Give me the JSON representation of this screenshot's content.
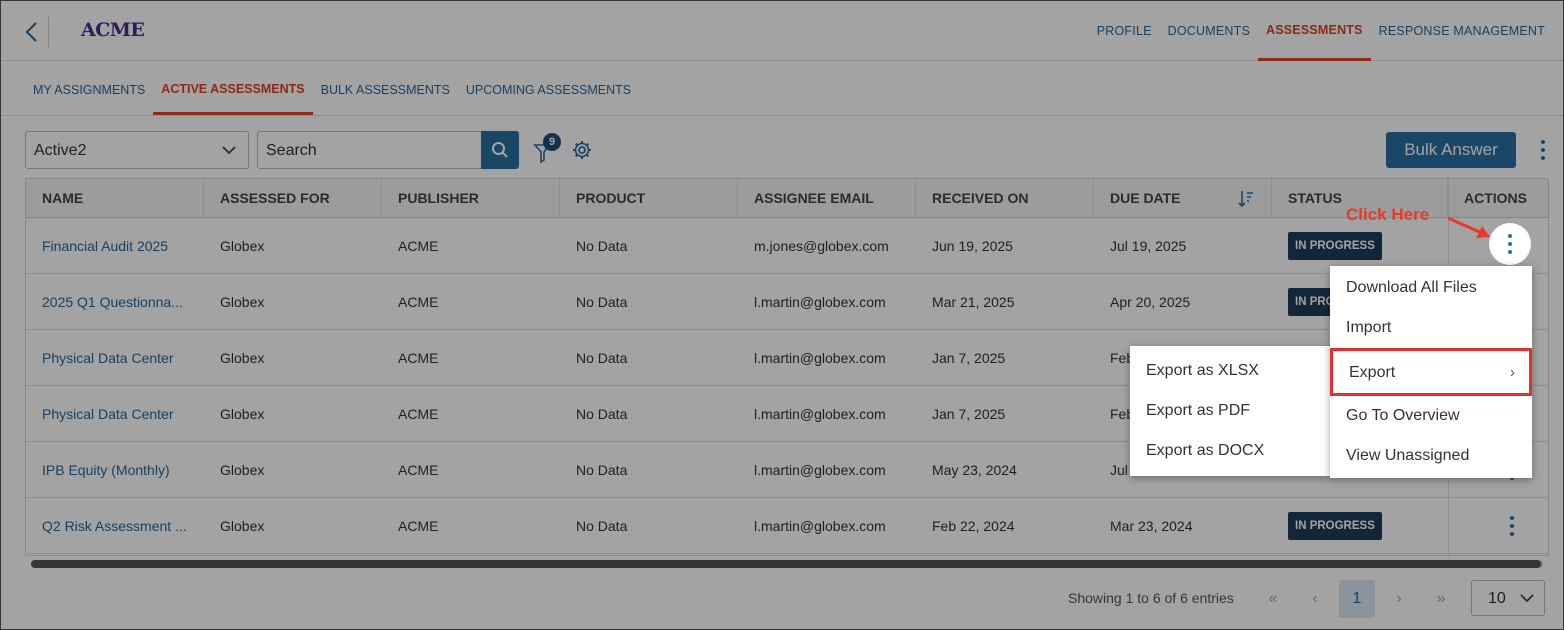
{
  "logo": "ACME",
  "top_nav": [
    {
      "label": "PROFILE",
      "active": false
    },
    {
      "label": "DOCUMENTS",
      "active": false
    },
    {
      "label": "ASSESSMENTS",
      "active": true
    },
    {
      "label": "RESPONSE MANAGEMENT",
      "active": false
    }
  ],
  "sub_tabs": [
    {
      "label": "MY ASSIGNMENTS",
      "active": false
    },
    {
      "label": "ACTIVE ASSESSMENTS",
      "active": true
    },
    {
      "label": "BULK ASSESSMENTS",
      "active": false
    },
    {
      "label": "UPCOMING ASSESSMENTS",
      "active": false
    }
  ],
  "toolbar": {
    "view_select": "Active2",
    "search_placeholder": "Search",
    "filter_count": "9",
    "bulk_answer_label": "Bulk Answer"
  },
  "table": {
    "columns": [
      "NAME",
      "ASSESSED FOR",
      "PUBLISHER",
      "PRODUCT",
      "ASSIGNEE EMAIL",
      "RECEIVED ON",
      "DUE DATE",
      "STATUS",
      "ACTIONS"
    ],
    "rows": [
      {
        "name": "Financial Audit 2025",
        "assessed_for": "Globex",
        "publisher": "ACME",
        "product": "No Data",
        "email": "m.jones@globex.com",
        "received": "Jun 19, 2025",
        "due": "Jul 19, 2025",
        "status": "IN PROGRESS"
      },
      {
        "name": "2025 Q1 Questionna...",
        "assessed_for": "Globex",
        "publisher": "ACME",
        "product": "No Data",
        "email": "l.martin@globex.com",
        "received": "Mar 21, 2025",
        "due": "Apr 20, 2025",
        "status": "IN PRO"
      },
      {
        "name": "Physical Data Center",
        "assessed_for": "Globex",
        "publisher": "ACME",
        "product": "No Data",
        "email": "l.martin@globex.com",
        "received": "Jan 7, 2025",
        "due": "Feb",
        "status": ""
      },
      {
        "name": "Physical Data Center",
        "assessed_for": "Globex",
        "publisher": "ACME",
        "product": "No Data",
        "email": "l.martin@globex.com",
        "received": "Jan 7, 2025",
        "due": "Feb",
        "status": ""
      },
      {
        "name": "IPB Equity (Monthly)",
        "assessed_for": "Globex",
        "publisher": "ACME",
        "product": "No Data",
        "email": "l.martin@globex.com",
        "received": "May 23, 2024",
        "due": "Jul",
        "status": ""
      },
      {
        "name": "Q2 Risk Assessment ...",
        "assessed_for": "Globex",
        "publisher": "ACME",
        "product": "No Data",
        "email": "l.martin@globex.com",
        "received": "Feb 22, 2024",
        "due": "Mar 23, 2024",
        "status": "IN PROGRESS"
      }
    ]
  },
  "callout": "Click Here",
  "actions_menu": [
    {
      "label": "Download All Files"
    },
    {
      "label": "Import"
    },
    {
      "label": "Export",
      "has_submenu": true
    },
    {
      "label": "Go To Overview"
    },
    {
      "label": "View Unassigned"
    }
  ],
  "export_submenu": [
    {
      "label": "Export as XLSX"
    },
    {
      "label": "Export as PDF"
    },
    {
      "label": "Export as DOCX"
    }
  ],
  "pagination": {
    "showing": "Showing 1 to 6 of 6 entries",
    "first": "«",
    "prev": "‹",
    "current_page": "1",
    "next": "›",
    "last": "»",
    "page_size": "10"
  },
  "colors": {
    "accent_active": "#d9442a",
    "link": "#2a6496",
    "primary_button": "#2a6fa0",
    "status_badge": "#1f3d5c",
    "highlight_border": "#e03030",
    "callout_text": "#e83a2a"
  },
  "icons": [
    "chevron-left-icon",
    "chevron-down-icon",
    "search-icon",
    "filter-icon",
    "gear-icon",
    "kebab-icon",
    "sort-icon",
    "chevron-right-icon",
    "arrow-icon"
  ]
}
